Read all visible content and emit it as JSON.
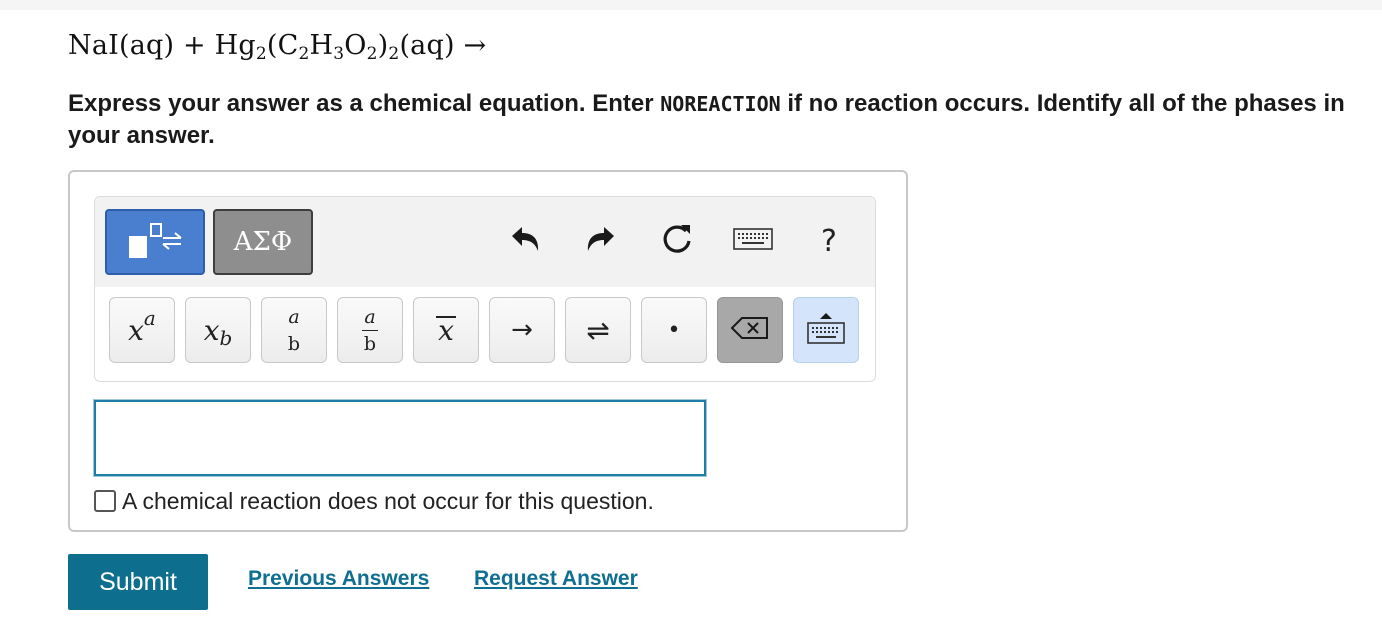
{
  "question": {
    "equation_parts": {
      "lhs1": "NaI(aq) + Hg",
      "sub1": "2",
      "lhs2": "(C",
      "sub2": "2",
      "lhs3": "H",
      "sub3": "3",
      "lhs4": "O",
      "sub4": "2",
      "lhs5": ")",
      "sub5": "2",
      "lhs6": "(aq)  →"
    },
    "instructions_before": "Express your answer as a chemical equation. Enter ",
    "instructions_code": "NOREACTION",
    "instructions_after": " if no reaction occurs. Identify all of the phases in your answer."
  },
  "toolbar": {
    "tabs": [
      {
        "name": "templates",
        "icon": "templates-icon",
        "active": true
      },
      {
        "name": "greek",
        "label": "ΑΣΦ",
        "active": false
      }
    ],
    "tools": {
      "undo_icon": "undo-icon",
      "redo_icon": "redo-icon",
      "reset_icon": "reset-icon",
      "keyboard_icon": "keyboard-icon",
      "help_label": "?"
    },
    "keys": {
      "sup_base": "x",
      "sup_exp": "a",
      "sub_base": "x",
      "sub_idx": "b",
      "frac1_num": "a",
      "frac1_den": "b",
      "frac2_num": "a",
      "frac2_den": "b",
      "bar_label": "x",
      "arrow_label": "→",
      "equil_label": "⇌",
      "dot_label": "•",
      "backspace_icon": "backspace-icon",
      "toggle_keyboard_icon": "keyboard-toggle-icon"
    }
  },
  "answer": {
    "value": "",
    "no_reaction_label": "A chemical reaction does not occur for this question.",
    "no_reaction_checked": false
  },
  "actions": {
    "submit_label": "Submit",
    "previous_answers_label": "Previous Answers",
    "request_answer_label": "Request Answer"
  },
  "colors": {
    "template_tab": "#4a7fd0",
    "greek_tab": "#8e8e8e",
    "submit": "#0e6e8e",
    "link": "#0f6f92",
    "input_border": "#1f7ca4"
  }
}
